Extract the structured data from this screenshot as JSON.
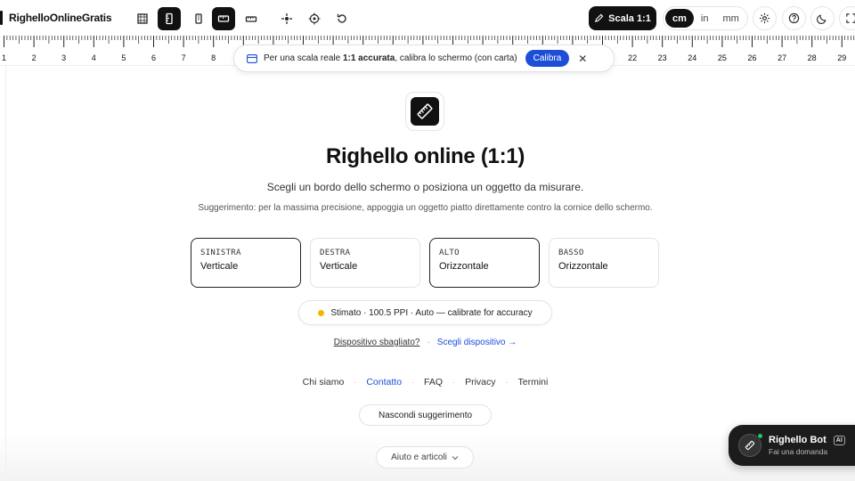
{
  "app": {
    "brand": "RighelloOnlineGratis"
  },
  "toolbar": {
    "tools": [
      {
        "name": "grid-icon"
      },
      {
        "name": "vertical-ruler-icon",
        "active": true
      },
      {
        "name": "tablet-icon"
      },
      {
        "name": "horizontal-ruler-icon",
        "active": true
      },
      {
        "name": "ruler-icon"
      },
      {
        "name": "crosshair-icon"
      },
      {
        "name": "target-icon"
      },
      {
        "name": "reset-icon"
      }
    ],
    "scale_label": "Scala 1:1",
    "units": [
      "cm",
      "in",
      "mm"
    ],
    "active_unit": "cm",
    "right_icons": [
      "settings-icon",
      "help-icon",
      "theme-icon",
      "fullscreen-icon"
    ]
  },
  "ruler": {
    "unit": "cm",
    "numbers": [
      "1",
      "2",
      "3",
      "4",
      "5",
      "6",
      "7",
      "8",
      "22",
      "23",
      "24",
      "25",
      "26",
      "27",
      "28",
      "29"
    ]
  },
  "banner": {
    "text_prefix": "Per una scala reale ",
    "text_bold": "1:1 accurata",
    "text_suffix": ", calibra lo schermo (con carta)",
    "calibrate_label": "Calibra",
    "close_icon": "close-icon"
  },
  "main": {
    "title": "Righello online (1:1)",
    "subtitle": "Scegli un bordo dello schermo o posiziona un oggetto da misurare.",
    "hint": "Suggerimento: per la massima precisione, appoggia un oggetto piatto direttamente contro la cornice dello schermo.",
    "edges": [
      {
        "key": "SINISTRA",
        "label": "Verticale",
        "selected": true
      },
      {
        "key": "DESTRA",
        "label": "Verticale",
        "selected": false
      },
      {
        "key": "ALTO",
        "label": "Orizzontale",
        "selected": true
      },
      {
        "key": "BASSO",
        "label": "Orizzontale",
        "selected": false
      }
    ],
    "status": "Stimato · 100.5 PPI · Auto — calibrate for accuracy",
    "status_color": "#f5b800",
    "device_wrong": "Dispositivo sbagliato?",
    "device_separator": "·",
    "device_choose": "Scegli dispositivo →"
  },
  "footer": {
    "links": [
      "Chi siamo",
      "Contatto",
      "FAQ",
      "Privacy",
      "Termini"
    ],
    "active_link": "Contatto",
    "hide_hint": "Nascondi suggerimento",
    "help_articles": "Aiuto e articoli"
  },
  "bot": {
    "name": "Righello Bot",
    "badge": "AI",
    "subtitle": "Fai una domanda"
  },
  "colors": {
    "accent": "#1d4ed8",
    "dark": "#111111"
  }
}
